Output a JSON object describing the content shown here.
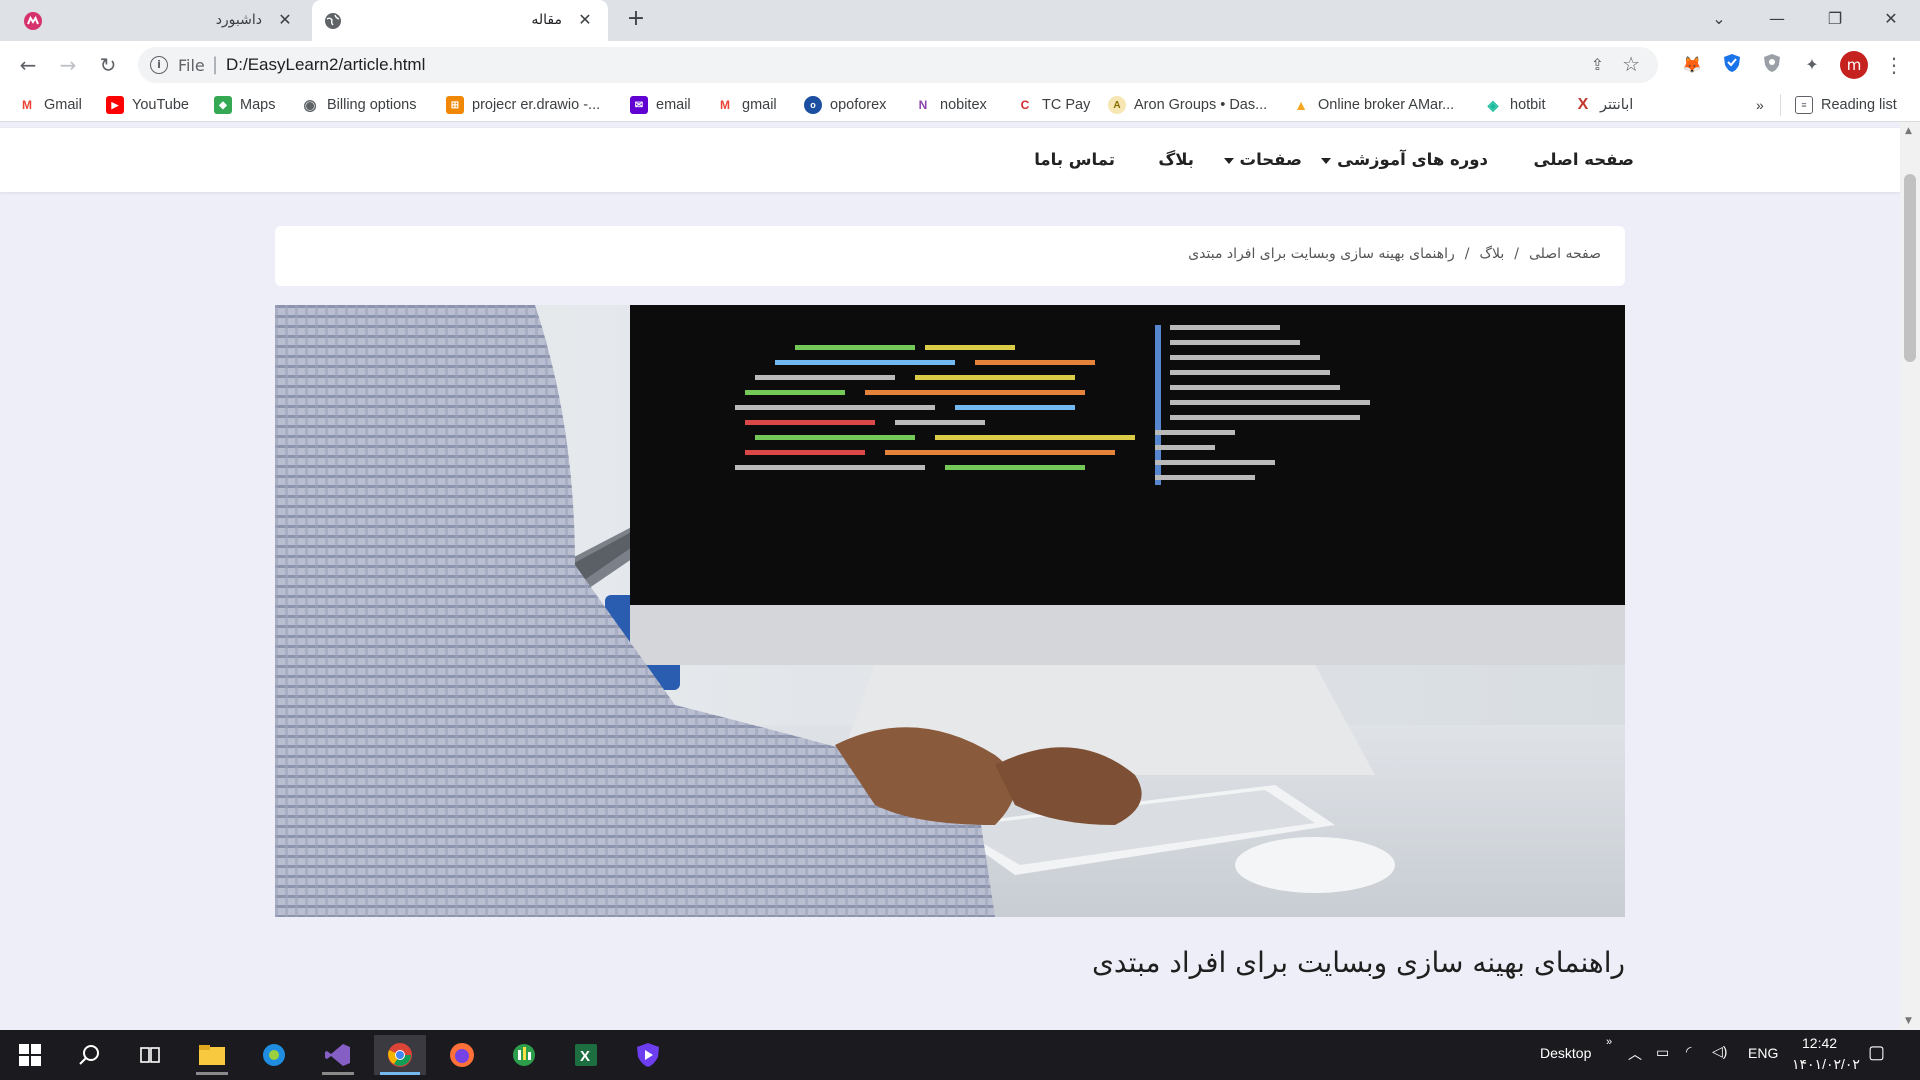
{
  "browser": {
    "tabs": [
      {
        "title": "داشبورد",
        "active": false
      },
      {
        "title": "مقاله",
        "active": true
      }
    ],
    "url_scheme": "File",
    "url": "D:/EasyLearn2/article.html",
    "avatar_letter": "m",
    "icons": {
      "back": "arrow-left-icon",
      "forward": "arrow-right-icon",
      "reload": "reload-icon",
      "share": "share-icon",
      "star": "bookmark-star-icon",
      "extensions": "puzzle-icon",
      "menu": "kebab-menu-icon"
    }
  },
  "bookmarks": [
    {
      "label": "Gmail"
    },
    {
      "label": "YouTube"
    },
    {
      "label": "Maps"
    },
    {
      "label": "Billing options"
    },
    {
      "label": "projecr er.drawio -..."
    },
    {
      "label": "email"
    },
    {
      "label": "gmail"
    },
    {
      "label": "opoforex"
    },
    {
      "label": "nobitex"
    },
    {
      "label": "TC Pay"
    },
    {
      "label": "Aron Groups • Das..."
    },
    {
      "label": "Online broker AMar..."
    },
    {
      "label": "hotbit"
    },
    {
      "label": "ابانتتر"
    }
  ],
  "bookmarks_overflow": "»",
  "reading_list": "Reading list",
  "site": {
    "nav": {
      "home": "صفحه اصلی",
      "courses": "دوره های آموزشی",
      "pages": "صفحات",
      "blog": "بلاگ",
      "contact": "تماس باما"
    },
    "breadcrumb": {
      "home": "صفحه اصلی",
      "sep": "/",
      "blog": "بلاگ",
      "current": "راهنمای بهینه سازی وبسایت برای افراد مبتدی"
    },
    "article_title": "راهنمای بهینه سازی وبسایت برای افراد مبتدی"
  },
  "taskbar": {
    "desktop_label": "Desktop",
    "language": "ENG",
    "time": "12:42",
    "date": "۱۴۰۱/۰۲/۰۲"
  },
  "colors": {
    "accent_nav": "#222222",
    "page_bg": "#eeeef8",
    "taskbar_bg": "#1b1b1f",
    "avatar_bg": "#c5221f"
  }
}
